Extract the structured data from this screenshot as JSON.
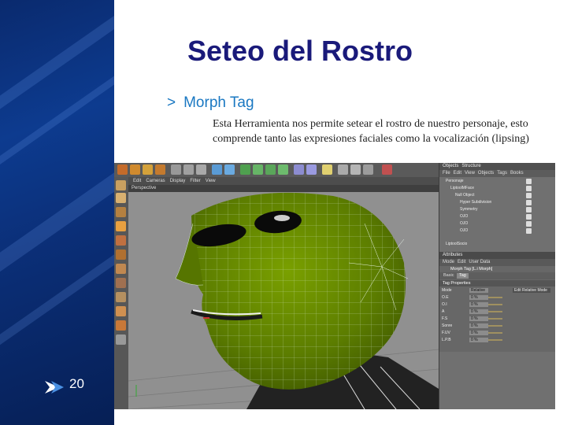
{
  "slide": {
    "title": "Seteo del Rostro",
    "bullet_mark": ">",
    "bullet_text": "Morph Tag",
    "body": "Esta Herramienta nos permite setear el rostro de nuestro personaje, esto comprende tanto las expresiones faciales como la vocalización (lipsing)",
    "slide_number": "20"
  },
  "app": {
    "viewport_menu": [
      "Edit",
      "Cameras",
      "Display",
      "Filter",
      "View"
    ],
    "viewport_label": "Perspective",
    "right_tabs": [
      "Objects",
      "Structure"
    ],
    "object_menu": [
      "File",
      "Edit",
      "View",
      "Objects",
      "Tags",
      "Books"
    ],
    "object_rows": [
      "Personaje",
      "LiptoolMFace",
      "Null Object",
      "Hyper Subdivision",
      "Symmetry",
      "OJO",
      "OJO",
      "OJO",
      "LiptoolSocio"
    ],
    "attr_header": "Attributes",
    "attr_menu": [
      "Mode",
      "Edit",
      "User Data"
    ],
    "attr_title": "Morph Tag [L.i Morph]",
    "attr_tabs": [
      "Basic",
      "Tag"
    ],
    "attr_section": "Tag Properties",
    "attr_mode_value": "Relative",
    "attr_mode_extra": "Edit Relative Mode",
    "attr_rows": [
      {
        "label": "Mode",
        "value": "Relative"
      },
      {
        "label": "O.E",
        "value": "0 %"
      },
      {
        "label": "O.I",
        "value": "0 %"
      },
      {
        "label": "A",
        "value": "0 %"
      },
      {
        "label": "F.S",
        "value": "0 %"
      },
      {
        "label": "Sonre",
        "value": "0 %"
      },
      {
        "label": "F.UV",
        "value": "0 %"
      },
      {
        "label": "L.P.B",
        "value": "0 %"
      }
    ]
  }
}
